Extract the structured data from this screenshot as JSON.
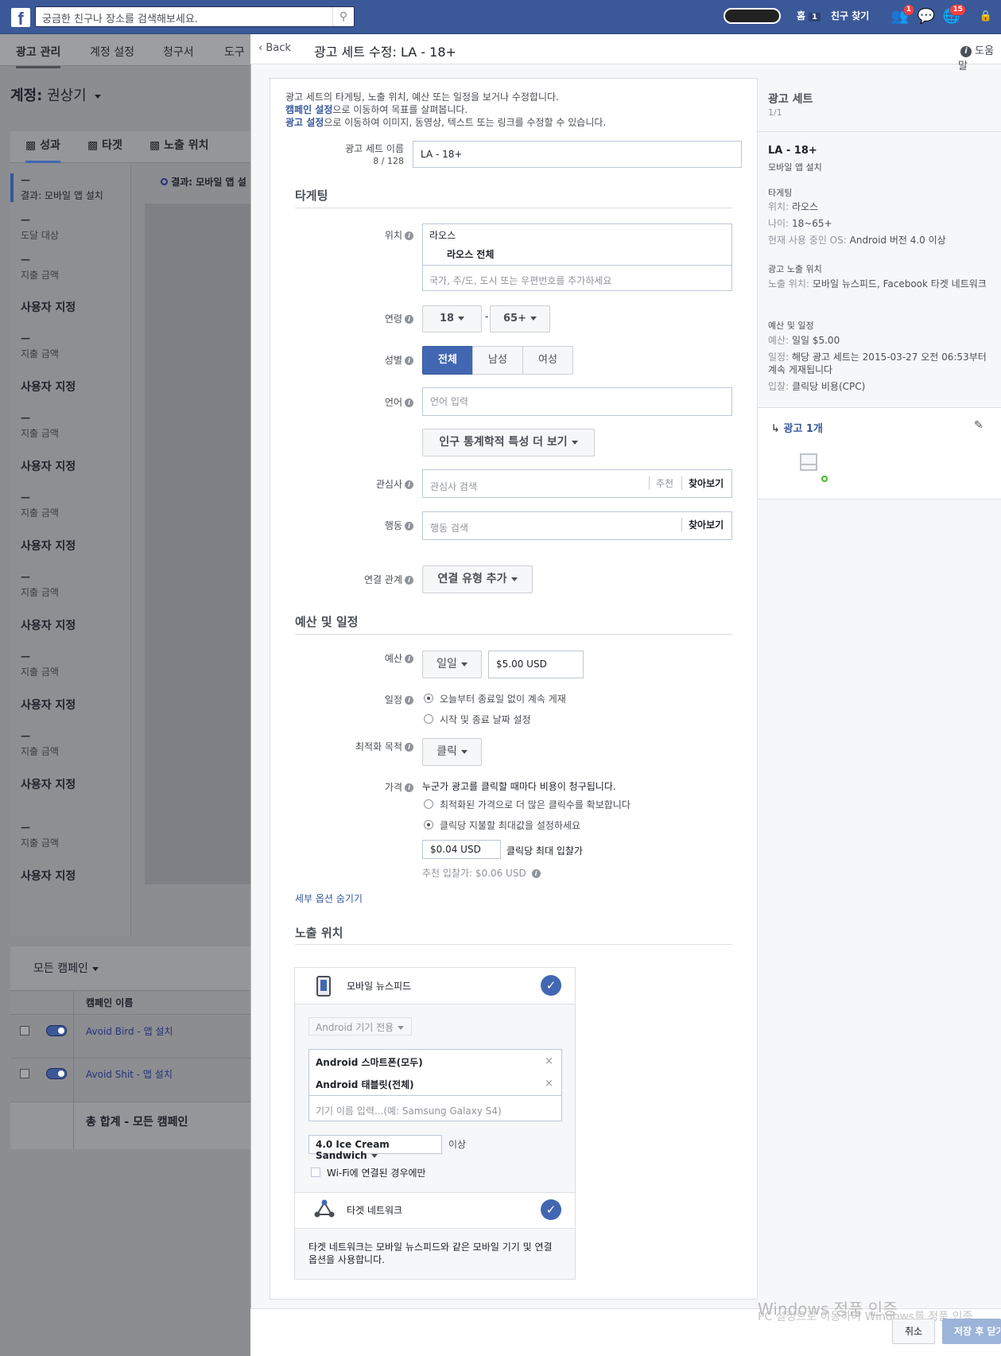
{
  "topbar": {
    "search_placeholder": "궁금한 친구나 장소를 검색해보세요.",
    "home_label": "홈",
    "home_count": "1",
    "find_friends": "친구 찾기",
    "friend_requests_count": "1",
    "notifications_count": "15"
  },
  "left": {
    "tabs": [
      "광고 관리",
      "계정 설정",
      "청구서",
      "도구"
    ],
    "account_prefix": "계정:",
    "account_name": "권상기",
    "perf_tabs": [
      "성과",
      "타겟",
      "노출 위치"
    ],
    "result_label": "결과: 모바일 앱 설치",
    "chart_result_label": "결과: 모바일 앱 설",
    "metrics": [
      {
        "dash": "—",
        "label": "도달 대상"
      },
      {
        "dash": "—",
        "label": "지출 금액",
        "custom": "사용자 지정"
      },
      {
        "dash": "—",
        "label": "지출 금액",
        "custom": "사용자 지정"
      },
      {
        "dash": "—",
        "label": "지출 금액",
        "custom": "사용자 지정"
      },
      {
        "dash": "—",
        "label": "지출 금액",
        "custom": "사용자 지정"
      },
      {
        "dash": "—",
        "label": "지출 금액",
        "custom": "사용자 지정"
      },
      {
        "dash": "—",
        "label": "지출 금액",
        "custom": "사용자 지정"
      },
      {
        "dash": "—",
        "label": "지출 금액",
        "custom": "사용자 지정"
      },
      {
        "dash": "—",
        "label": "지출 금액",
        "custom": "사용자 지정"
      }
    ],
    "campaign_filter": "모든 캠페인",
    "campaign_col": "캠페인 이름",
    "campaigns": [
      "Avoid Bird - 앱 설치",
      "Avoid Shit - 앱 설치"
    ],
    "total": "총 합계 - 모든 캠페인"
  },
  "modal": {
    "back": "Back",
    "title": "광고 세트 수정: LA - 18+",
    "help": "도움말",
    "intro_line1": "광고 세트의 타게팅, 노출 위치, 예산 또는 일정을 보거나 수정합니다.",
    "intro_link2": "캠페인 설정",
    "intro_line2": "으로 이동하여 목표를 살펴봅니다.",
    "intro_link3": "광고 설정",
    "intro_line3": "으로 이동하여 이미지, 동영상, 텍스트 또는 링크를 수정할 수 있습니다.",
    "adset_name_label": "광고 세트 이름",
    "adset_name_count": "8 / 128",
    "adset_name_value": "LA - 18+",
    "targeting_title": "타게팅",
    "location_label": "위치",
    "location_country": "라오스",
    "location_item": "라오스 전체",
    "location_placeholder": "국가, 주/도, 도시 또는 우편번호를 추가하세요",
    "age_label": "연령",
    "age_min": "18",
    "age_sep": "-",
    "age_max": "65+",
    "gender_label": "성별",
    "gender_options": [
      "전체",
      "남성",
      "여성"
    ],
    "language_label": "언어",
    "language_placeholder": "언어 입력",
    "more_demo": "인구 통계학적 특성 더 보기",
    "interests_label": "관심사",
    "interests_placeholder": "관심사 검색",
    "suggest": "추천",
    "browse": "찾아보기",
    "behaviors_label": "행동",
    "behaviors_placeholder": "행동 검색",
    "connections_label": "연결 관계",
    "connections_btn": "연결 유형 추가",
    "budget_title": "예산 및 일정",
    "budget_label": "예산",
    "budget_type": "일일",
    "budget_value": "$5.00 USD",
    "schedule_label": "일정",
    "schedule_opt1": "오늘부터 종료일 없이 계속 게재",
    "schedule_opt2": "시작 및 종료 날짜 설정",
    "optimize_label": "최적화 목적",
    "optimize_value": "클릭",
    "price_label": "가격",
    "price_desc": "누군가 광고를 클릭할 때마다 비용이 청구됩니다.",
    "price_opt1": "최적화된 가격으로 더 많은 클릭수를 확보합니다",
    "price_opt2": "클릭당 지불할 최대값을 설정하세요",
    "bid_value": "$0.04 USD",
    "bid_label": "클릭당 최대 입찰가",
    "suggested_bid": "추천 입찰가: $0.06 USD",
    "hide_options": "세부 옵션 숨기기",
    "placement_title": "노출 위치",
    "mobile_feed": "모바일 뉴스피드",
    "device_filter": "Android 기기 전용",
    "devices": [
      "Android 스마트폰(모두)",
      "Android 태블릿(전체)"
    ],
    "device_placeholder": "기기 이름 입력...(예: Samsung Galaxy S4)",
    "os_version": "4.0 Ice Cream Sandwich",
    "os_above": "이상",
    "wifi_only": "Wi-Fi에 연결된 경우에만",
    "audience_network": "타겟 네트워크",
    "audience_network_desc": "타겟 네트워크는 모바일 뉴스피드와 같은 모바일 기기 및 연결 옵션을 사용합니다."
  },
  "side": {
    "title": "광고 세트",
    "count": "1/1",
    "adset_name": "LA - 18+",
    "objective": "모바일 앱 설치",
    "targeting_h": "타게팅",
    "loc_k": "위치:",
    "loc_v": "라오스",
    "age_k": "나이:",
    "age_v": "18~65+",
    "os_k": "현재 사용 중인 OS:",
    "os_v": "Android 버전 4.0 이상",
    "placement_h": "광고 노출 위치",
    "place_k": "노출 위치:",
    "place_v": "모바일 뉴스피드, Facebook 타겟 네트워크",
    "budget_h": "예산 및 일정",
    "budget_k": "예산:",
    "budget_v": "일일 $5.00",
    "schedule_k": "일정:",
    "schedule_v": "해당 광고 세트는 2015-03-27 오전 06:53부터 계속 게재됩니다",
    "bid_k": "입찰:",
    "bid_v": "클릭당 비용(CPC)",
    "ads_link": "광고 1개"
  },
  "footer": {
    "cancel": "취소",
    "save": "저장 후 닫기"
  },
  "watermark": {
    "line1": "Windows 정품 인증",
    "line2": "PC 설정으로 이동하여 Windows를 정품 인증"
  }
}
